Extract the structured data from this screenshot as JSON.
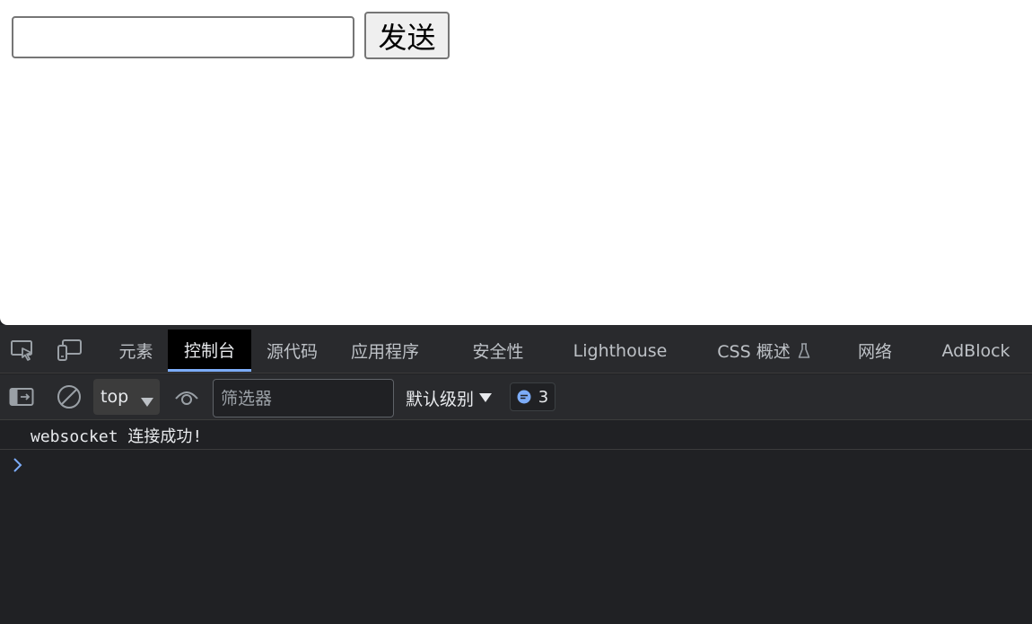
{
  "page": {
    "message_input_value": "",
    "send_button_label": "发送"
  },
  "devtools": {
    "tabs": [
      {
        "label": "元素",
        "active": false
      },
      {
        "label": "控制台",
        "active": true
      },
      {
        "label": "源代码",
        "active": false
      },
      {
        "label": "应用程序",
        "active": false
      },
      {
        "label": "安全性",
        "active": false
      },
      {
        "label": "Lighthouse",
        "active": false
      },
      {
        "label": "CSS 概述",
        "active": false,
        "icon": "flask-icon"
      },
      {
        "label": "网络",
        "active": false
      },
      {
        "label": "AdBlock",
        "active": false
      }
    ],
    "toolbar": {
      "context": "top",
      "filter_placeholder": "筛选器",
      "filter_value": "",
      "level": "默认级别",
      "issues_count": "3"
    },
    "console": {
      "messages": [
        "websocket 连接成功!"
      ]
    },
    "colors": {
      "accent": "#7cacf8",
      "panel_bg": "#292a2d",
      "console_bg": "#202124",
      "text": "#e8eaed"
    }
  }
}
